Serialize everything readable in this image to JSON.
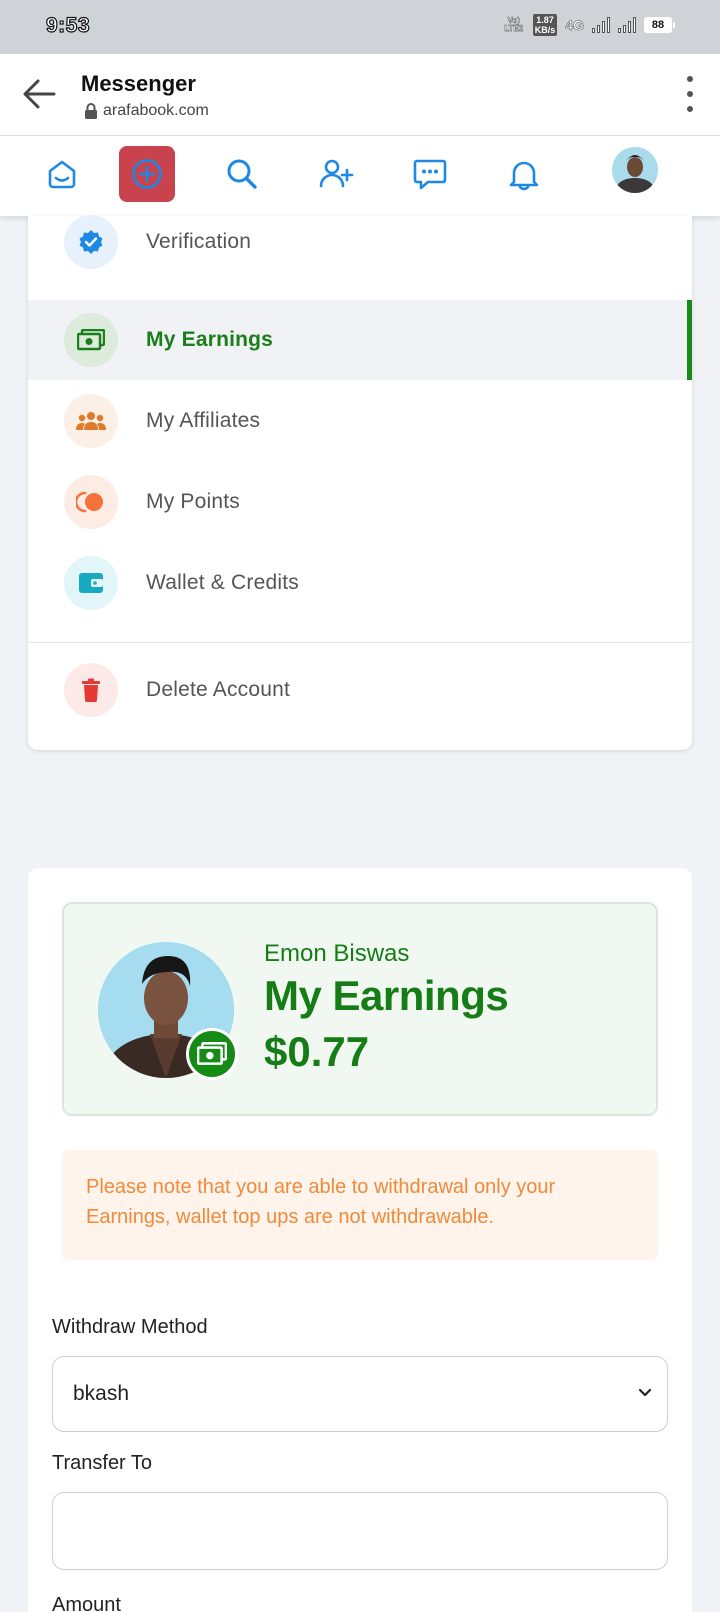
{
  "status_bar": {
    "time": "9:53",
    "volte": "Vo) LTE2",
    "speed_value": "1.87",
    "speed_unit": "KB/s",
    "network": "4G",
    "battery": "88"
  },
  "browser": {
    "title": "Messenger",
    "url": "arafabook.com"
  },
  "nav_icons": [
    "home-icon",
    "create-post-icon",
    "search-icon",
    "add-friend-icon",
    "messages-icon",
    "notifications-icon",
    "profile-avatar"
  ],
  "menu": {
    "items": [
      {
        "label": "Verification",
        "icon": "verified-badge-icon",
        "color": "#1e88e5"
      },
      {
        "label": "My Earnings",
        "icon": "money-icon",
        "color": "#1a7e1a",
        "active": true
      },
      {
        "label": "My Affiliates",
        "icon": "people-group-icon",
        "color": "#e07b2a"
      },
      {
        "label": "My Points",
        "icon": "points-icon",
        "color": "#f4733a"
      },
      {
        "label": "Wallet & Credits",
        "icon": "wallet-icon",
        "color": "#18a9c2"
      },
      {
        "label": "Delete Account",
        "icon": "trash-icon",
        "color": "#e53935"
      }
    ]
  },
  "earnings": {
    "user_name": "Emon Biswas",
    "title": "My Earnings",
    "amount": "$0.77",
    "notice": "Please note that you are able to withdrawal only your Earnings, wallet top ups are not withdrawable."
  },
  "form": {
    "withdraw_method_label": "Withdraw Method",
    "withdraw_method_value": "bkash",
    "transfer_to_label": "Transfer To",
    "transfer_to_value": "",
    "amount_label": "Amount"
  },
  "colors": {
    "accent_blue": "#1e88e5",
    "earnings_green": "#167d16",
    "create_button": "#c9434f",
    "notice_text": "#ee8a3a"
  }
}
